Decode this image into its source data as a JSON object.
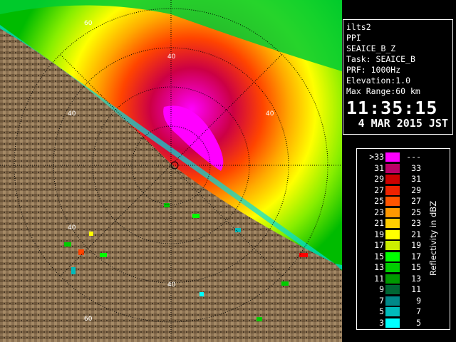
{
  "info": {
    "radar_name": "ilts2",
    "scan_type": "PPI",
    "product": "SEAICE_B_Z",
    "task": "Task: SEAICE_B",
    "prf": "PRF: 1000Hz",
    "elevation": "Elevation:1.0",
    "max_range": "Max Range:60 km",
    "time": "11:35:15",
    "date": "4 MAR 2015 JST"
  },
  "legend": {
    "title": "Reflectivity in dBZ",
    "rows": [
      {
        "left": ">33",
        "right": "---",
        "color": "#ff00ff"
      },
      {
        "left": "31",
        "right": "33",
        "color": "#bb0066"
      },
      {
        "left": "29",
        "right": "31",
        "color": "#cc0000"
      },
      {
        "left": "27",
        "right": "29",
        "color": "#ee2200"
      },
      {
        "left": "25",
        "right": "27",
        "color": "#ff5500"
      },
      {
        "left": "23",
        "right": "25",
        "color": "#ff9900"
      },
      {
        "left": "21",
        "right": "23",
        "color": "#ffcc00"
      },
      {
        "left": "19",
        "right": "21",
        "color": "#ffff00"
      },
      {
        "left": "17",
        "right": "19",
        "color": "#ccee00"
      },
      {
        "left": "15",
        "right": "17",
        "color": "#00ff00"
      },
      {
        "left": "13",
        "right": "15",
        "color": "#00cc00"
      },
      {
        "left": "11",
        "right": "13",
        "color": "#009900"
      },
      {
        "left": "9",
        "right": "11",
        "color": "#006633"
      },
      {
        "left": "7",
        "right": "9",
        "color": "#008888"
      },
      {
        "left": "5",
        "right": "7",
        "color": "#00bbbb"
      },
      {
        "left": "3",
        "right": "5",
        "color": "#00ffff"
      }
    ]
  },
  "map": {
    "range_ring_labels": [
      "40",
      "60"
    ],
    "land_color": "#8a7050",
    "ring_color": "#ffffff"
  }
}
